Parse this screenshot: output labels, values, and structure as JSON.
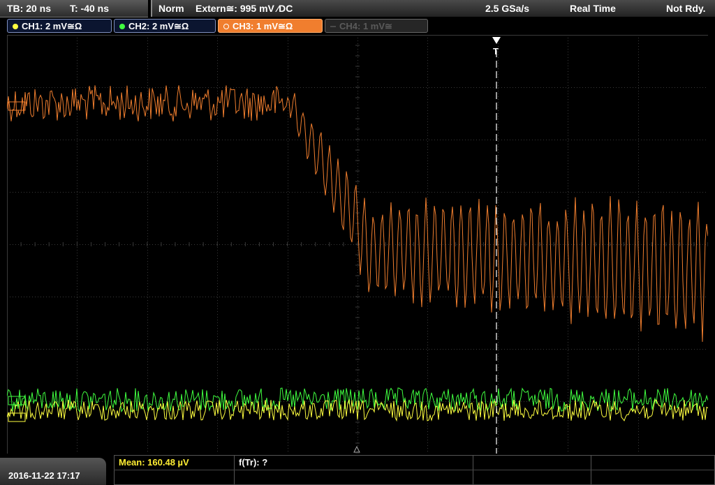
{
  "status_bar": {
    "timebase": "TB: 20 ns",
    "trigger_time": "T: -40 ns",
    "trigger_mode": "Norm",
    "trigger_source": "Extern≅: 995 mV ⁄DC",
    "sample_rate": "2.5 GSa/s",
    "acq_mode": "Real Time",
    "state": "Not Rdy."
  },
  "channels": [
    {
      "label": "CH1: 2 mV≅Ω",
      "color": "#ffff40",
      "active": true
    },
    {
      "label": "CH2: 2 mV≅Ω",
      "color": "#40ff40",
      "active": true
    },
    {
      "label": "CH3: 1 mV≅Ω",
      "color": "#f07e2e",
      "active": true
    },
    {
      "label": "CH4: 1 mV≅",
      "color": "#5a5a5a",
      "active": false
    }
  ],
  "trigger_marker": {
    "label": "T"
  },
  "measurements": {
    "mean": "Mean: 160.48 µV",
    "ftr": "f(Tr): ?"
  },
  "datetime": "2016-11-22 17:17",
  "colors": {
    "grid": "#3a3a3a",
    "ch1": "#ffff40",
    "ch2": "#40ff40",
    "ch3": "#f07e2e",
    "trigger_line": "#ffffff"
  }
}
